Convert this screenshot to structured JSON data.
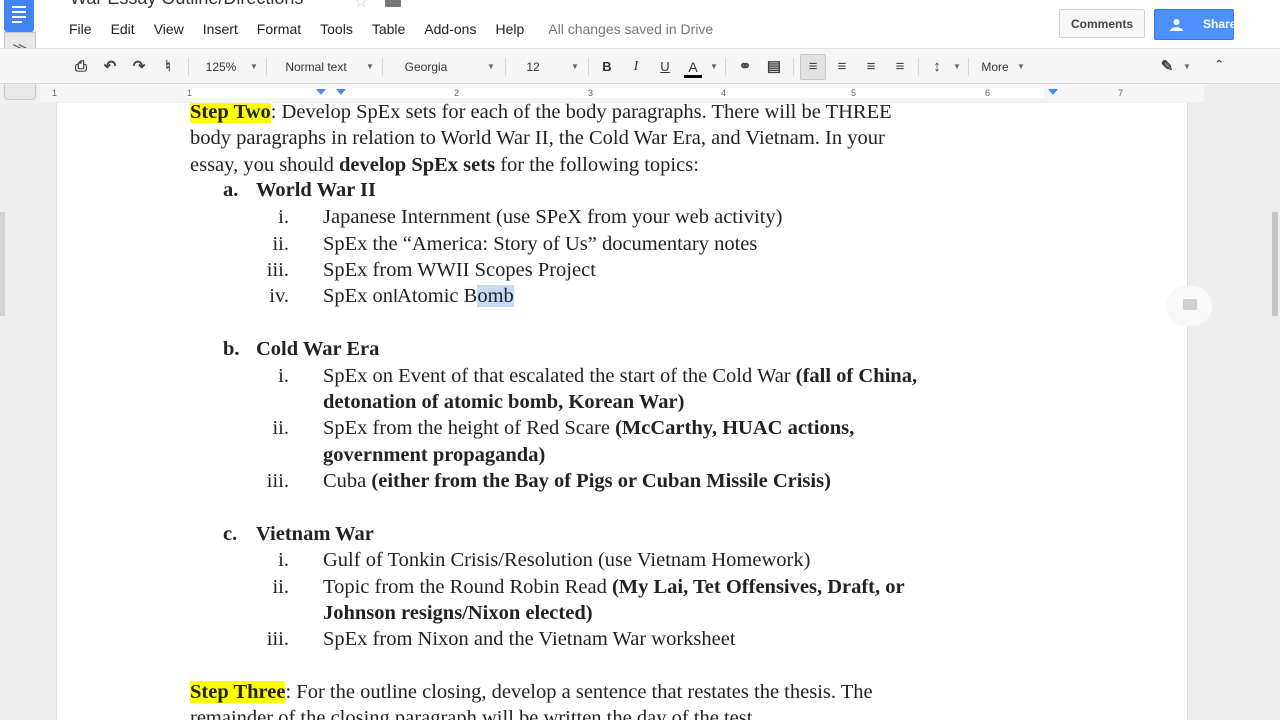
{
  "app": {
    "doc_title": "War Essay Outline/Directions",
    "save_status": "All changes saved in Drive",
    "comments_label": "Comments",
    "share_label": "Share",
    "accent_color": "#4d90fe",
    "highlight_color": "#ffff00"
  },
  "menu": [
    "File",
    "Edit",
    "View",
    "Insert",
    "Format",
    "Tools",
    "Table",
    "Add-ons",
    "Help"
  ],
  "toolbar": {
    "zoom": "125%",
    "style": "Normal text",
    "font": "Georgia",
    "size": "12",
    "bold": "B",
    "italic": "I",
    "underline": "U",
    "text_color": "A",
    "more": "More",
    "icons": [
      "print-icon",
      "undo-icon",
      "redo-icon",
      "paint-format-icon",
      "link-icon",
      "comment-icon",
      "align-left-icon",
      "align-center-icon",
      "align-right-icon",
      "align-justify-icon",
      "line-spacing-icon",
      "pen-icon",
      "collapse-icon"
    ]
  },
  "ruler": {
    "numbers": [
      "1",
      "1",
      "2",
      "3",
      "4",
      "5",
      "6",
      "7"
    ]
  },
  "doc": {
    "step_two_label": "Step Two",
    "step_two_rest": ": Develop SpEx sets for each of the body paragraphs.  There will be THREE",
    "line2": "body paragraphs in relation to World War II, the Cold War Era, and Vietnam.  In your",
    "line3_a": "essay, you should ",
    "line3_b": "develop SpEx sets",
    "line3_c": " for the following topics:",
    "sec_a_mark": "a.",
    "sec_a_title": "World War II",
    "a1_num": "i.",
    "a1": "Japanese Internment (use SPeX from your web activity)",
    "a2_num": "ii.",
    "a2": "SpEx the “America: Story of Us” documentary notes",
    "a3_num": "iii.",
    "a3": "SpEx from WWII Scopes Project",
    "a4_num": "iv.",
    "a4_pre": "SpEx on Atomic B",
    "a4_sel": "omb",
    "sec_b_mark": "b.",
    "sec_b_title": "Cold War Era",
    "b1_num": "i.",
    "b1_a": "SpEx on Event of that escalated the start of the Cold War ",
    "b1_b": "(fall of China,",
    "b1_c": "detonation of atomic bomb, Korean War)",
    "b2_num": "ii.",
    "b2_a": "SpEx from the height of Red Scare ",
    "b2_b": "(McCarthy, HUAC actions,",
    "b2_c": "government propaganda)",
    "b3_num": "iii.",
    "b3_a": "Cuba ",
    "b3_b": "(either from the Bay of Pigs or Cuban Missile Crisis)",
    "sec_c_mark": "c.",
    "sec_c_title": "Vietnam War",
    "c1_num": "i.",
    "c1": "Gulf of Tonkin Crisis/Resolution (use Vietnam Homework)",
    "c2_num": "ii.",
    "c2_a": "Topic from the Round Robin Read ",
    "c2_b": "(My Lai, Tet Offensives, Draft, or",
    "c2_c": "Johnson resigns/Nixon elected)",
    "c3_num": "iii.",
    "c3": "SpEx from Nixon and the Vietnam War worksheet",
    "step_three_label": "Step Three",
    "step_three_rest": ": For the outline closing, develop a sentence that restates the thesis.  The",
    "last_line": "remainder of the closing paragraph will be written the day of the test."
  }
}
